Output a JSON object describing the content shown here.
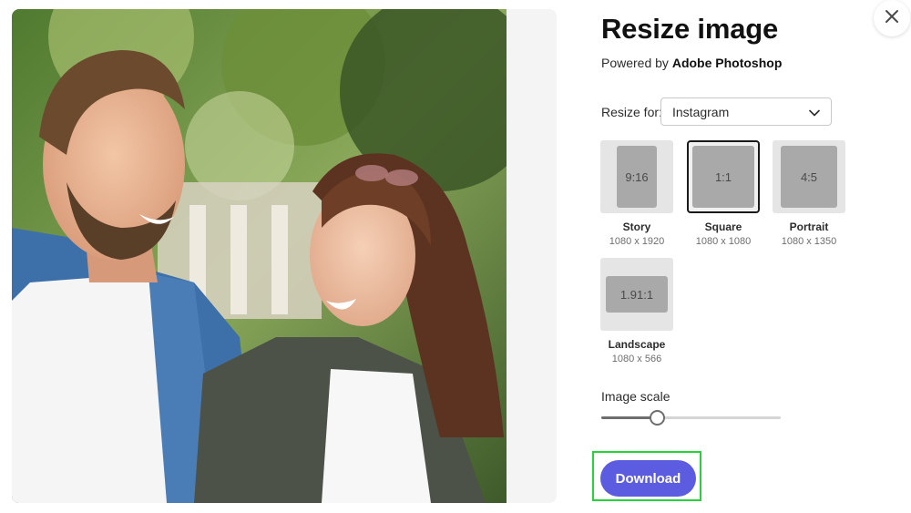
{
  "header": {
    "title": "Resize image",
    "powered_by_prefix": "Powered by",
    "powered_by_brand": "Adobe Photoshop"
  },
  "close": {
    "icon": "close-icon"
  },
  "resize_for": {
    "label": "Resize for:",
    "selected": "Instagram",
    "icon": "chevron-down-icon"
  },
  "sizes": [
    {
      "ratio": "9:16",
      "name": "Story",
      "dims": "1080 x 1920",
      "selected": false
    },
    {
      "ratio": "1:1",
      "name": "Square",
      "dims": "1080 x 1080",
      "selected": true
    },
    {
      "ratio": "4:5",
      "name": "Portrait",
      "dims": "1080 x 1350",
      "selected": false
    },
    {
      "ratio": "1.91:1",
      "name": "Landscape",
      "dims": "1080 x 566",
      "selected": false
    }
  ],
  "scale": {
    "label": "Image scale",
    "value_fraction": 0.31
  },
  "download": {
    "label": "Download"
  },
  "colors": {
    "accent": "#5c5ce0",
    "highlight": "#27d33a",
    "tile": "#e5e5e5",
    "tile_shape": "#a9a9a9"
  }
}
